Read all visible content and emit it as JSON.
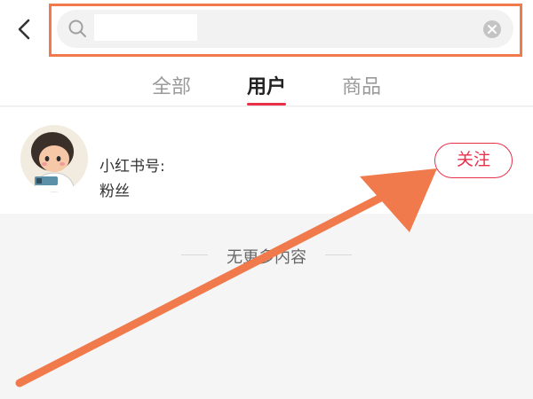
{
  "header": {
    "back_icon": "chevron-left-icon",
    "search": {
      "value": "",
      "placeholder": "",
      "search_icon": "search-icon",
      "clear_icon": "clear-icon"
    },
    "highlight_color": "#f07a4c"
  },
  "tabs": [
    {
      "label": "全部",
      "active": false
    },
    {
      "label": "用户",
      "active": true
    },
    {
      "label": "商品",
      "active": false
    }
  ],
  "result": {
    "avatar_icon": "avatar",
    "name": "小红书号:",
    "fans": "粉丝",
    "follow_label": "关注"
  },
  "footer": {
    "end_text": "无更多内容"
  },
  "colors": {
    "accent": "#e8304a",
    "annotation": "#f07a4c",
    "background": "#f5f5f5"
  }
}
